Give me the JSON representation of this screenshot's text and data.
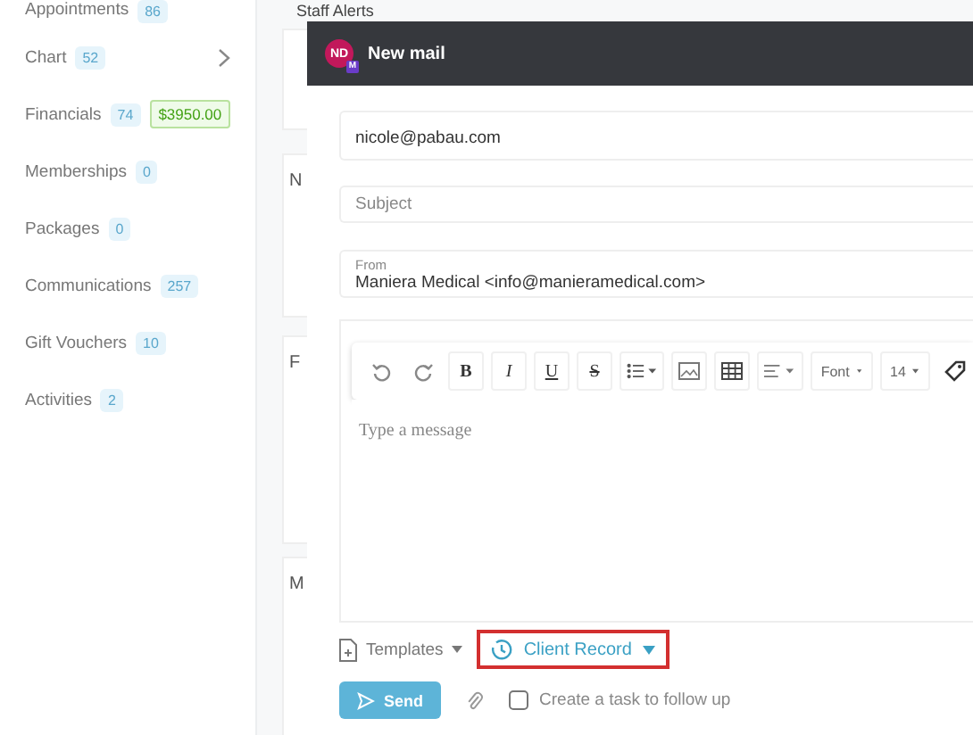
{
  "sidebar": {
    "items": [
      {
        "label": "Appointments",
        "count": "86",
        "expandable": false
      },
      {
        "label": "Chart",
        "count": "52",
        "expandable": true
      },
      {
        "label": "Financials",
        "count": "74",
        "amount": "$3950.00",
        "expandable": false
      },
      {
        "label": "Memberships",
        "count": "0",
        "expandable": false
      },
      {
        "label": "Packages",
        "count": "0",
        "expandable": false
      },
      {
        "label": "Communications",
        "count": "257",
        "expandable": false
      },
      {
        "label": "Gift Vouchers",
        "count": "10",
        "expandable": false
      },
      {
        "label": "Activities",
        "count": "2",
        "expandable": false
      }
    ]
  },
  "background": {
    "staff_alerts_title": "Staff Alerts",
    "card_titles": [
      "N",
      "F",
      "M"
    ]
  },
  "mail": {
    "title": "New mail",
    "avatar": "ND",
    "avatar_badge": "M",
    "to": "nicole@pabau.com",
    "subject_placeholder": "Subject",
    "from_label": "From",
    "from": "Maniera Medical <info@manieramedical.com>",
    "toolbar": [
      {
        "kind": "undo"
      },
      {
        "kind": "redo"
      },
      {
        "kind": "bold",
        "label": "B"
      },
      {
        "kind": "italic",
        "label": "I"
      },
      {
        "kind": "underline",
        "label": "U"
      },
      {
        "kind": "strike",
        "label": "S"
      },
      {
        "kind": "list"
      },
      {
        "kind": "image"
      },
      {
        "kind": "table"
      },
      {
        "kind": "align"
      },
      {
        "kind": "dropdown",
        "label": "Font"
      },
      {
        "kind": "dropdown",
        "label": "14"
      },
      {
        "kind": "tag"
      }
    ],
    "message_placeholder": "Type a message",
    "templates": "Templates",
    "client_record": {
      "label": "Client Record",
      "highlighted": true
    },
    "send": "Send",
    "follow_up": {
      "label": "Create a task to follow up",
      "checked": false
    }
  }
}
